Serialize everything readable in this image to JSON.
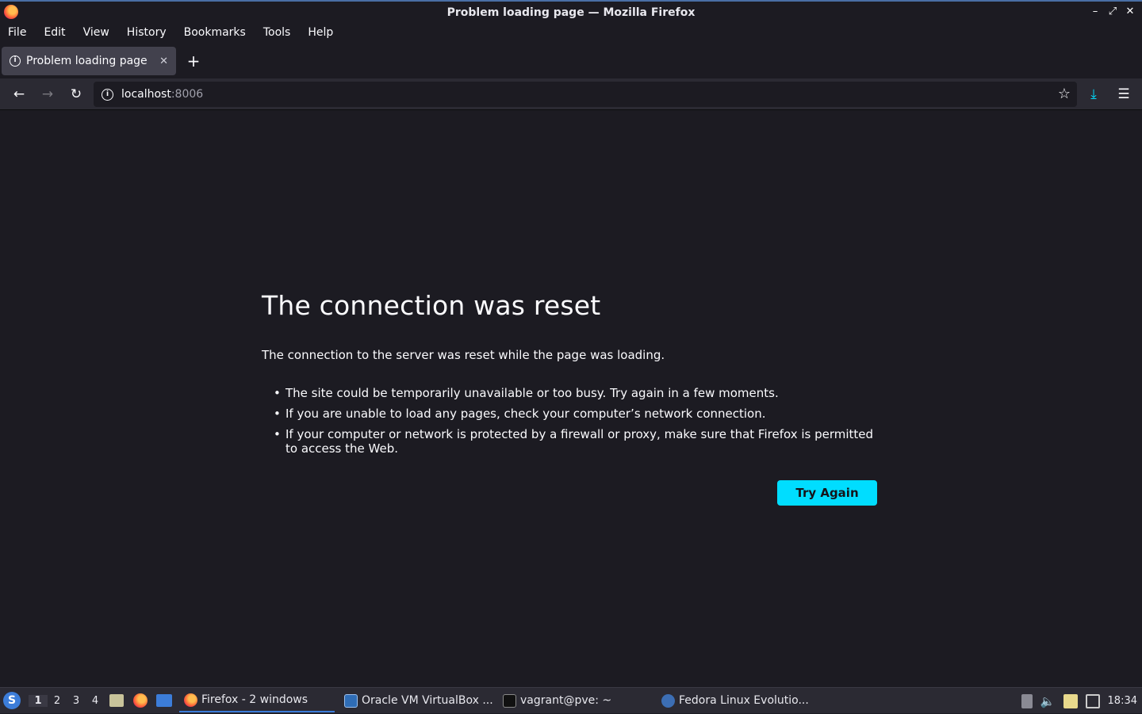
{
  "window": {
    "title": "Problem loading page — Mozilla Firefox",
    "controls": [
      "–",
      "⤢",
      "✕"
    ]
  },
  "menubar": {
    "items": [
      "File",
      "Edit",
      "View",
      "History",
      "Bookmarks",
      "Tools",
      "Help"
    ]
  },
  "tabs": {
    "active_label": "Problem loading page",
    "close_glyph": "✕",
    "new_tab_glyph": "+"
  },
  "navbar": {
    "back_glyph": "←",
    "forward_glyph": "→",
    "reload_glyph": "↻",
    "url_host": "localhost",
    "url_port": ":8006",
    "star_glyph": "☆",
    "download_glyph": "⤓",
    "menu_glyph": "☰"
  },
  "error": {
    "title": "The connection was reset",
    "description": "The connection to the server was reset while the page was loading.",
    "suggestions": [
      "The site could be temporarily unavailable or too busy. Try again in a few moments.",
      "If you are unable to load any pages, check your computer’s network connection.",
      "If your computer or network is protected by a firewall or proxy, make sure that Firefox is permitted to access the Web."
    ],
    "button_label": "Try Again"
  },
  "taskbar": {
    "workspaces": [
      "1",
      "2",
      "3",
      "4"
    ],
    "tasks": [
      {
        "label": "Firefox - 2 windows",
        "icon": "firefox-icon"
      },
      {
        "label": "Oracle VM VirtualBox ...",
        "icon": "virtualbox-icon"
      },
      {
        "label": "vagrant@pve: ~",
        "icon": "terminal-icon"
      },
      {
        "label": "Fedora Linux Evolutio...",
        "icon": "fedora-icon"
      }
    ],
    "clock": "18:34"
  },
  "colors": {
    "accent": "#00ddff",
    "background": "#1c1b22",
    "toolbar": "#2b2a33"
  }
}
